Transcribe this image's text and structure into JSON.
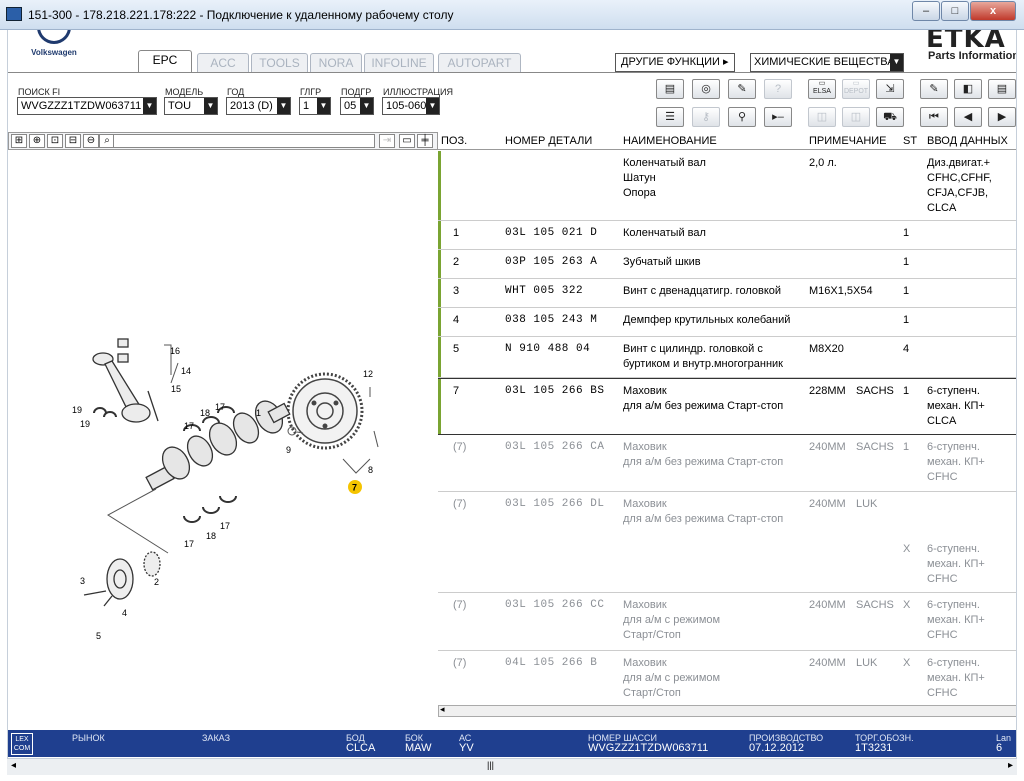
{
  "window": {
    "title": "151-300 - 178.218.221.178:222 - Подключение к удаленному рабочему столу",
    "minimize": "–",
    "maximize": "□",
    "close": "x"
  },
  "header": {
    "logo_text": "Volkswagen",
    "tabs": [
      "EPC",
      "ACC",
      "TOOLS",
      "NORA",
      "INFOLINE",
      "AUTOPART"
    ],
    "other_functions": "ДРУГИЕ ФУНКЦИИ ▸",
    "chem_select": "ХИМИЧЕСКИЕ ВЕЩЕСТВА",
    "etka_logo": "ETKA",
    "etka_sub": "Parts Information"
  },
  "filters": {
    "search_label": "ПОИСК FI",
    "search_value": "WVGZZZ1TZDW063711",
    "model_label": "МОДЕЛЬ",
    "model_value": "TOU",
    "year_label": "ГОД",
    "year_value": "2013 (D)",
    "mgrp_label": "ГЛГР",
    "mgrp_value": "1",
    "subgrp_label": "ПОДГР",
    "subgrp_value": "05",
    "illus_label": "ИЛЛЮСТРАЦИЯ",
    "illus_value": "105-060"
  },
  "toolbar": {
    "elsa": "ELSA",
    "depot": "DEPOT"
  },
  "table": {
    "headers": {
      "pos": "ПОЗ.",
      "num": "НОМЕР ДЕТАЛИ",
      "name": "НАИМЕНОВАНИЕ",
      "note": "ПРИМЕЧАНИЕ",
      "st": "ST",
      "entry": "ВВОД ДАННЫХ"
    },
    "rows": [
      {
        "pos": "",
        "num": "",
        "name": "Коленчатый вал\nШатун\nОпора",
        "note": "2,0 л.",
        "supp": "",
        "st": "",
        "entry": "Диз.двигат.+\nCFHC,CFHF,\nCFJA,CFJB,\nCLCA"
      },
      {
        "pos": "1",
        "num": "03L 105 021 D",
        "name": "Коленчатый вал",
        "note": "",
        "supp": "",
        "st": "1",
        "entry": ""
      },
      {
        "pos": "2",
        "num": "03P 105 263 A",
        "name": "Зубчатый шкив",
        "note": "",
        "supp": "",
        "st": "1",
        "entry": ""
      },
      {
        "pos": "3",
        "num": "WHT 005 322",
        "name": "Винт с двенадцатигр. головкой",
        "note": "M16X1,5X54",
        "supp": "",
        "st": "1",
        "entry": ""
      },
      {
        "pos": "4",
        "num": "038 105 243 M",
        "name": "Демпфер крутильных колебаний",
        "note": "",
        "supp": "",
        "st": "1",
        "entry": ""
      },
      {
        "pos": "5",
        "num": "N   910 488 04",
        "name": "Винт с цилиндр. головкой с\nбуртиком и внутр.многогранник",
        "note": "M8X20",
        "supp": "",
        "st": "4",
        "entry": ""
      },
      {
        "pos": "7",
        "num": "03L 105 266 BS",
        "name": "Маховик\nдля а/м без режима Старт-стоп",
        "note": "228MM",
        "supp": "SACHS",
        "st": "1",
        "entry": "6-ступенч.\nмехан. КП+\nCLCA"
      },
      {
        "pos": "(7)",
        "num": "03L 105 266 CA",
        "name": "Маховик\nдля а/м без режима Старт-стоп",
        "note": "240MM",
        "supp": "SACHS",
        "st": "1",
        "entry": "6-ступенч.\nмехан. КП+\nCFHC"
      },
      {
        "pos": "(7)",
        "num": "03L 105 266 DL",
        "name": "Маховик\nдля а/м без режима Старт-стоп",
        "note": "240MM",
        "supp": "LUK",
        "st": "\n\n\nX",
        "entry": "\n\n\n6-ступенч.\nмехан. КП+\nCFHC"
      },
      {
        "pos": "(7)",
        "num": "03L 105 266 CC",
        "name": "Маховик\nдля а/м с режимом\nСтарт/Стоп",
        "note": "240MM",
        "supp": "SACHS",
        "st": "X",
        "entry": "6-ступенч.\nмехан. КП+\nCFHC"
      },
      {
        "pos": "(7)",
        "num": "04L 105 266 B",
        "name": "Маховик\nдля а/м с режимом\nСтарт/Стоп",
        "note": "240MM",
        "supp": "LUK",
        "st": "X",
        "entry": "6-ступенч.\nмехан. КП+\nCFHC"
      }
    ]
  },
  "illustration": {
    "callouts": [
      "1",
      "2",
      "3",
      "4",
      "5",
      "7",
      "8",
      "9",
      "12",
      "14",
      "15",
      "16",
      "17",
      "18",
      "19"
    ],
    "highlight": "7",
    "accent": "#f5c400"
  },
  "status": {
    "market_label": "РЫНОК",
    "order_label": "ЗАКАЗ",
    "bod_label": "БОД",
    "bod_value": "CLCA",
    "bok_label": "БОК",
    "bok_value": "MAW",
    "ac_label": "АС",
    "ac_value": "YV",
    "chassis_label": "НОМЕР ШАССИ",
    "chassis_value": "WVGZZZ1TZDW063711",
    "prod_label": "ПРОИЗВОДСТВО",
    "prod_value": "07.12.2012",
    "trade_label": "ТОРГ.ОБОЗН.",
    "trade_value": "1T3231",
    "lang_label": "Lan",
    "lang_value": "6",
    "lexcom": "LEX COM"
  },
  "colors": {
    "status_bg": "#1f3f8f",
    "row_marker": "#7aa432"
  }
}
